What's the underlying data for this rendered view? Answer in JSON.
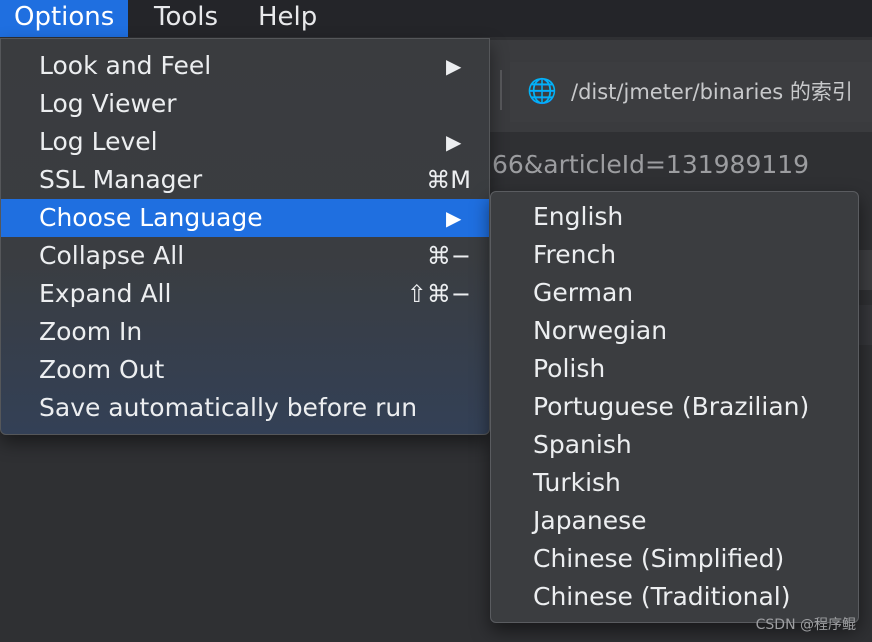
{
  "menubar": {
    "menus": [
      {
        "label": "Options",
        "active": true
      },
      {
        "label": "Tools",
        "active": false
      },
      {
        "label": "Help",
        "active": false
      }
    ]
  },
  "options_menu": {
    "items": [
      {
        "label": "Look and Feel",
        "submenu": true,
        "shortcut": ""
      },
      {
        "label": "Log Viewer",
        "submenu": false,
        "shortcut": ""
      },
      {
        "label": "Log Level",
        "submenu": true,
        "shortcut": ""
      },
      {
        "label": "SSL Manager",
        "submenu": false,
        "shortcut": "⌘M"
      },
      {
        "label": "Choose Language",
        "submenu": true,
        "shortcut": "",
        "highlighted": true
      },
      {
        "label": "Collapse All",
        "submenu": false,
        "shortcut": "⌘−"
      },
      {
        "label": "Expand All",
        "submenu": false,
        "shortcut": "⇧⌘−"
      },
      {
        "label": "Zoom In",
        "submenu": false,
        "shortcut": ""
      },
      {
        "label": "Zoom Out",
        "submenu": false,
        "shortcut": ""
      },
      {
        "label": "Save automatically before run",
        "submenu": false,
        "shortcut": ""
      }
    ],
    "arrow_glyph": "▶"
  },
  "language_submenu": {
    "items": [
      "English",
      "French",
      "German",
      "Norwegian",
      "Polish",
      "Portuguese (Brazilian)",
      "Spanish",
      "Turkish",
      "Japanese",
      "Chinese (Simplified)",
      "Chinese (Traditional)"
    ]
  },
  "background": {
    "address_text": "/dist/jmeter/binaries 的索引",
    "url_fragment": "66&articleId=131989119",
    "globe_icon": "globe-icon"
  },
  "watermark": "CSDN @程序鲲",
  "colors": {
    "accent": "#1f6fe0",
    "menu_bg": "#3a3c3f",
    "text": "#eceef0"
  }
}
